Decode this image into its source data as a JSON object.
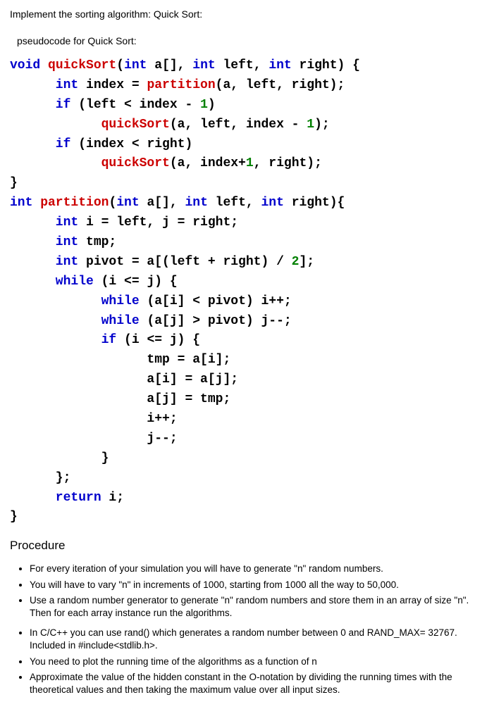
{
  "title": "Implement the sorting algorithm: Quick Sort:",
  "pseudo_label": "pseudocode for  Quick Sort:",
  "code": {
    "l1a": "void",
    "l1b": " quickSort",
    "l1c": "(",
    "l1d": "int",
    "l1e": " a[], ",
    "l1f": "int",
    "l1g": " left, ",
    "l1h": "int",
    "l1i": " right) {",
    "l2a": "      int",
    "l2b": " index = ",
    "l2c": "partition",
    "l2d": "(a, left, right);",
    "l3a": "      if",
    "l3b": " (left < index - ",
    "l3c": "1",
    "l3d": ")",
    "l4a": "            quickSort",
    "l4b": "(a, left, index - ",
    "l4c": "1",
    "l4d": ");",
    "l5a": "      if",
    "l5b": " (index < right)",
    "l6a": "            quickSort",
    "l6b": "(a, index+",
    "l6c": "1",
    "l6d": ", right);",
    "l7": "}",
    "l8a": "int",
    "l8b": " partition",
    "l8c": "(",
    "l8d": "int",
    "l8e": " a[], ",
    "l8f": "int",
    "l8g": " left, ",
    "l8h": "int",
    "l8i": " right){",
    "l9a": "      int",
    "l9b": " i = left, j = right;",
    "l10a": "      int",
    "l10b": " tmp;",
    "l11a": "      int",
    "l11b": " pivot = a[(left + right) / ",
    "l11c": "2",
    "l11d": "];",
    "l12a": "      while",
    "l12b": " (i <= j) {",
    "l13a": "            while",
    "l13b": " (a[i] < pivot) i++;",
    "l14a": "            while",
    "l14b": " (a[j] > pivot) j--;",
    "l15a": "            if",
    "l15b": " (i <= j) {",
    "l16": "                  tmp = a[i];",
    "l17": "                  a[i] = a[j];",
    "l18": "                  a[j] = tmp;",
    "l19": "                  i++;",
    "l20": "                  j--;",
    "l21": "            }",
    "l22": "      };",
    "l23a": "      return",
    "l23b": " i;",
    "l24": "}"
  },
  "procedure_heading": "Procedure",
  "procedure": [
    "For every iteration of your simulation you will have to generate \"n\" random numbers.",
    "You will have to vary \"n\" in increments of 1000, starting from  1000 all the way to 50,000.",
    "Use a random number generator to generate \"n\" random numbers and store them in an array of size \"n\". Then for each array instance run the algorithms.",
    "In C/C++  you can use rand() which generates a random number between 0 and RAND_MAX= 32767. Included in #include<stdlib.h>.",
    "You need to plot the running time of the algorithms as a function of n",
    "Approximate the value of the hidden constant in the O-notation by dividing the running times with the theoretical values and then taking the maximum value over all input sizes."
  ]
}
